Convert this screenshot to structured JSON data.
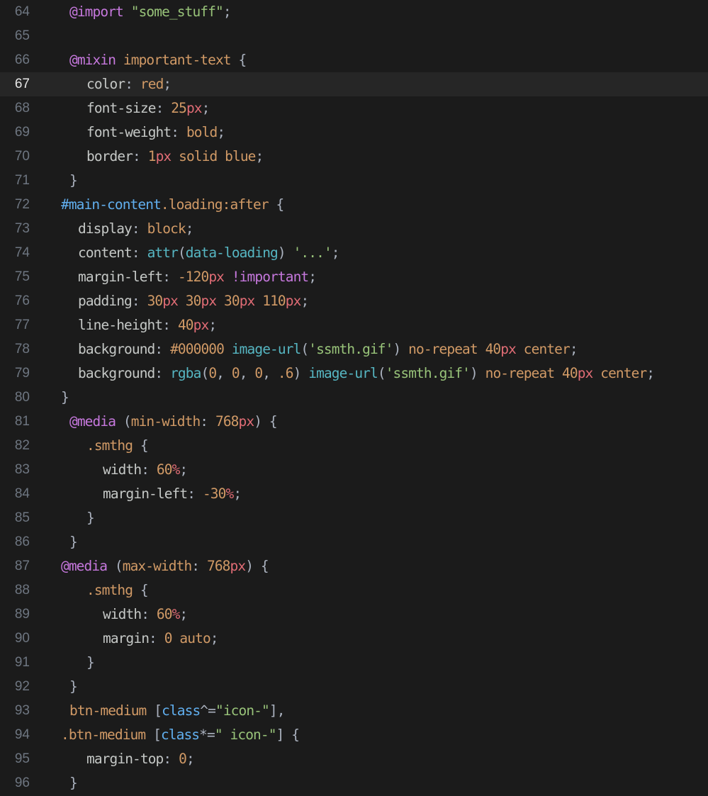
{
  "editor": {
    "current_line": 67,
    "lines": [
      {
        "n": "64",
        "indent": 98,
        "tokens": [
          [
            "@import",
            "at"
          ],
          [
            " ",
            "default"
          ],
          [
            "\"some_stuff\"",
            "string"
          ],
          [
            ";",
            "punct"
          ]
        ]
      },
      {
        "n": "65",
        "indent": 98,
        "tokens": []
      },
      {
        "n": "66",
        "indent": 98,
        "tokens": [
          [
            "@mixin",
            "at"
          ],
          [
            " important-text ",
            "value"
          ],
          [
            "{",
            "punct"
          ]
        ]
      },
      {
        "n": "67",
        "indent": 122,
        "tokens": [
          [
            "color",
            "prop"
          ],
          [
            ": ",
            "punct"
          ],
          [
            "red",
            "value"
          ],
          [
            ";",
            "punct"
          ]
        ]
      },
      {
        "n": "68",
        "indent": 122,
        "tokens": [
          [
            "font-size",
            "prop"
          ],
          [
            ": ",
            "punct"
          ],
          [
            "25",
            "number"
          ],
          [
            "px",
            "unit"
          ],
          [
            ";",
            "punct"
          ]
        ]
      },
      {
        "n": "69",
        "indent": 122,
        "tokens": [
          [
            "font-weight",
            "prop"
          ],
          [
            ": ",
            "punct"
          ],
          [
            "bold",
            "value"
          ],
          [
            ";",
            "punct"
          ]
        ]
      },
      {
        "n": "70",
        "indent": 122,
        "tokens": [
          [
            "border",
            "prop"
          ],
          [
            ": ",
            "punct"
          ],
          [
            "1",
            "number"
          ],
          [
            "px",
            "unit"
          ],
          [
            " solid blue",
            "value"
          ],
          [
            ";",
            "punct"
          ]
        ]
      },
      {
        "n": "71",
        "indent": 98,
        "tokens": [
          [
            "}",
            "punct"
          ]
        ]
      },
      {
        "n": "72",
        "indent": 86,
        "tokens": [
          [
            "#main-content",
            "id"
          ],
          [
            ".loading",
            "class"
          ],
          [
            ":after",
            "value"
          ],
          [
            " {",
            "punct"
          ]
        ]
      },
      {
        "n": "73",
        "indent": 110,
        "tokens": [
          [
            "display",
            "prop"
          ],
          [
            ": ",
            "punct"
          ],
          [
            "block",
            "value"
          ],
          [
            ";",
            "punct"
          ]
        ]
      },
      {
        "n": "74",
        "indent": 110,
        "tokens": [
          [
            "content",
            "prop"
          ],
          [
            ": ",
            "punct"
          ],
          [
            "attr",
            "func"
          ],
          [
            "(",
            "punct"
          ],
          [
            "data-loading",
            "func"
          ],
          [
            ") ",
            "punct"
          ],
          [
            "'...'",
            "string"
          ],
          [
            ";",
            "punct"
          ]
        ]
      },
      {
        "n": "75",
        "indent": 110,
        "tokens": [
          [
            "margin-left",
            "prop"
          ],
          [
            ": ",
            "punct"
          ],
          [
            "-120",
            "number"
          ],
          [
            "px",
            "unit"
          ],
          [
            " ",
            "default"
          ],
          [
            "!important",
            "important"
          ],
          [
            ";",
            "punct"
          ]
        ]
      },
      {
        "n": "76",
        "indent": 110,
        "tokens": [
          [
            "padding",
            "prop"
          ],
          [
            ": ",
            "punct"
          ],
          [
            "30",
            "number"
          ],
          [
            "px",
            "unit"
          ],
          [
            " ",
            "default"
          ],
          [
            "30",
            "number"
          ],
          [
            "px",
            "unit"
          ],
          [
            " ",
            "default"
          ],
          [
            "30",
            "number"
          ],
          [
            "px",
            "unit"
          ],
          [
            " ",
            "default"
          ],
          [
            "110",
            "number"
          ],
          [
            "px",
            "unit"
          ],
          [
            ";",
            "punct"
          ]
        ]
      },
      {
        "n": "77",
        "indent": 110,
        "tokens": [
          [
            "line-height",
            "prop"
          ],
          [
            ": ",
            "punct"
          ],
          [
            "40",
            "number"
          ],
          [
            "px",
            "unit"
          ],
          [
            ";",
            "punct"
          ]
        ]
      },
      {
        "n": "78",
        "indent": 110,
        "tokens": [
          [
            "background",
            "prop"
          ],
          [
            ": ",
            "punct"
          ],
          [
            "#000000",
            "hex"
          ],
          [
            " ",
            "default"
          ],
          [
            "image-url",
            "func"
          ],
          [
            "(",
            "punct"
          ],
          [
            "'ssmth.gif'",
            "string"
          ],
          [
            ")",
            "punct"
          ],
          [
            " no-repeat ",
            "value"
          ],
          [
            "40",
            "number"
          ],
          [
            "px",
            "unit"
          ],
          [
            " center",
            "value"
          ],
          [
            ";",
            "punct"
          ]
        ]
      },
      {
        "n": "79",
        "indent": 110,
        "tokens": [
          [
            "background",
            "prop"
          ],
          [
            ": ",
            "punct"
          ],
          [
            "rgba",
            "func"
          ],
          [
            "(",
            "punct"
          ],
          [
            "0",
            "number"
          ],
          [
            ", ",
            "punct"
          ],
          [
            "0",
            "number"
          ],
          [
            ", ",
            "punct"
          ],
          [
            "0",
            "number"
          ],
          [
            ", ",
            "punct"
          ],
          [
            ".6",
            "number"
          ],
          [
            ") ",
            "punct"
          ],
          [
            "image-url",
            "func"
          ],
          [
            "(",
            "punct"
          ],
          [
            "'ssmth.gif'",
            "string"
          ],
          [
            ")",
            "punct"
          ],
          [
            " no-repeat ",
            "value"
          ],
          [
            "40",
            "number"
          ],
          [
            "px",
            "unit"
          ],
          [
            " center",
            "value"
          ],
          [
            ";",
            "punct"
          ]
        ]
      },
      {
        "n": "80",
        "indent": 86,
        "tokens": [
          [
            "}",
            "punct"
          ]
        ]
      },
      {
        "n": "81",
        "indent": 98,
        "tokens": [
          [
            "@media",
            "at"
          ],
          [
            " (",
            "punct"
          ],
          [
            "min-width",
            "value"
          ],
          [
            ": ",
            "punct"
          ],
          [
            "768",
            "number"
          ],
          [
            "px",
            "unit"
          ],
          [
            ") {",
            "punct"
          ]
        ]
      },
      {
        "n": "82",
        "indent": 122,
        "tokens": [
          [
            ".smthg",
            "class"
          ],
          [
            " {",
            "punct"
          ]
        ]
      },
      {
        "n": "83",
        "indent": 145,
        "tokens": [
          [
            "width",
            "prop"
          ],
          [
            ": ",
            "punct"
          ],
          [
            "60",
            "number"
          ],
          [
            "%",
            "unit"
          ],
          [
            ";",
            "punct"
          ]
        ]
      },
      {
        "n": "84",
        "indent": 145,
        "tokens": [
          [
            "margin-left",
            "prop"
          ],
          [
            ": ",
            "punct"
          ],
          [
            "-30",
            "number"
          ],
          [
            "%",
            "unit"
          ],
          [
            ";",
            "punct"
          ]
        ]
      },
      {
        "n": "85",
        "indent": 122,
        "tokens": [
          [
            "}",
            "punct"
          ]
        ]
      },
      {
        "n": "86",
        "indent": 98,
        "tokens": [
          [
            "}",
            "punct"
          ]
        ]
      },
      {
        "n": "87",
        "indent": 86,
        "tokens": [
          [
            "@media",
            "at"
          ],
          [
            " (",
            "punct"
          ],
          [
            "max-width",
            "value"
          ],
          [
            ": ",
            "punct"
          ],
          [
            "768",
            "number"
          ],
          [
            "px",
            "unit"
          ],
          [
            ") {",
            "punct"
          ]
        ]
      },
      {
        "n": "88",
        "indent": 122,
        "tokens": [
          [
            ".smthg",
            "class"
          ],
          [
            " {",
            "punct"
          ]
        ]
      },
      {
        "n": "89",
        "indent": 145,
        "tokens": [
          [
            "width",
            "prop"
          ],
          [
            ": ",
            "punct"
          ],
          [
            "60",
            "number"
          ],
          [
            "%",
            "unit"
          ],
          [
            ";",
            "punct"
          ]
        ]
      },
      {
        "n": "90",
        "indent": 145,
        "tokens": [
          [
            "margin",
            "prop"
          ],
          [
            ": ",
            "punct"
          ],
          [
            "0",
            "number"
          ],
          [
            " auto",
            "value"
          ],
          [
            ";",
            "punct"
          ]
        ]
      },
      {
        "n": "91",
        "indent": 122,
        "tokens": [
          [
            "}",
            "punct"
          ]
        ]
      },
      {
        "n": "92",
        "indent": 98,
        "tokens": [
          [
            "}",
            "punct"
          ]
        ]
      },
      {
        "n": "93",
        "indent": 98,
        "tokens": [
          [
            "btn-medium",
            "value"
          ],
          [
            " [",
            "punct"
          ],
          [
            "class",
            "id"
          ],
          [
            "^=",
            "punct"
          ],
          [
            "\"icon-\"",
            "string"
          ],
          [
            "],",
            "punct"
          ]
        ]
      },
      {
        "n": "94",
        "indent": 86,
        "tokens": [
          [
            ".btn-medium",
            "class"
          ],
          [
            " [",
            "punct"
          ],
          [
            "class",
            "id"
          ],
          [
            "*=",
            "punct"
          ],
          [
            "\" icon-\"",
            "string"
          ],
          [
            "] {",
            "punct"
          ]
        ]
      },
      {
        "n": "95",
        "indent": 122,
        "tokens": [
          [
            "margin-top",
            "prop"
          ],
          [
            ": ",
            "punct"
          ],
          [
            "0",
            "number"
          ],
          [
            ";",
            "punct"
          ]
        ]
      },
      {
        "n": "96",
        "indent": 98,
        "tokens": [
          [
            "}",
            "punct"
          ]
        ]
      }
    ]
  }
}
